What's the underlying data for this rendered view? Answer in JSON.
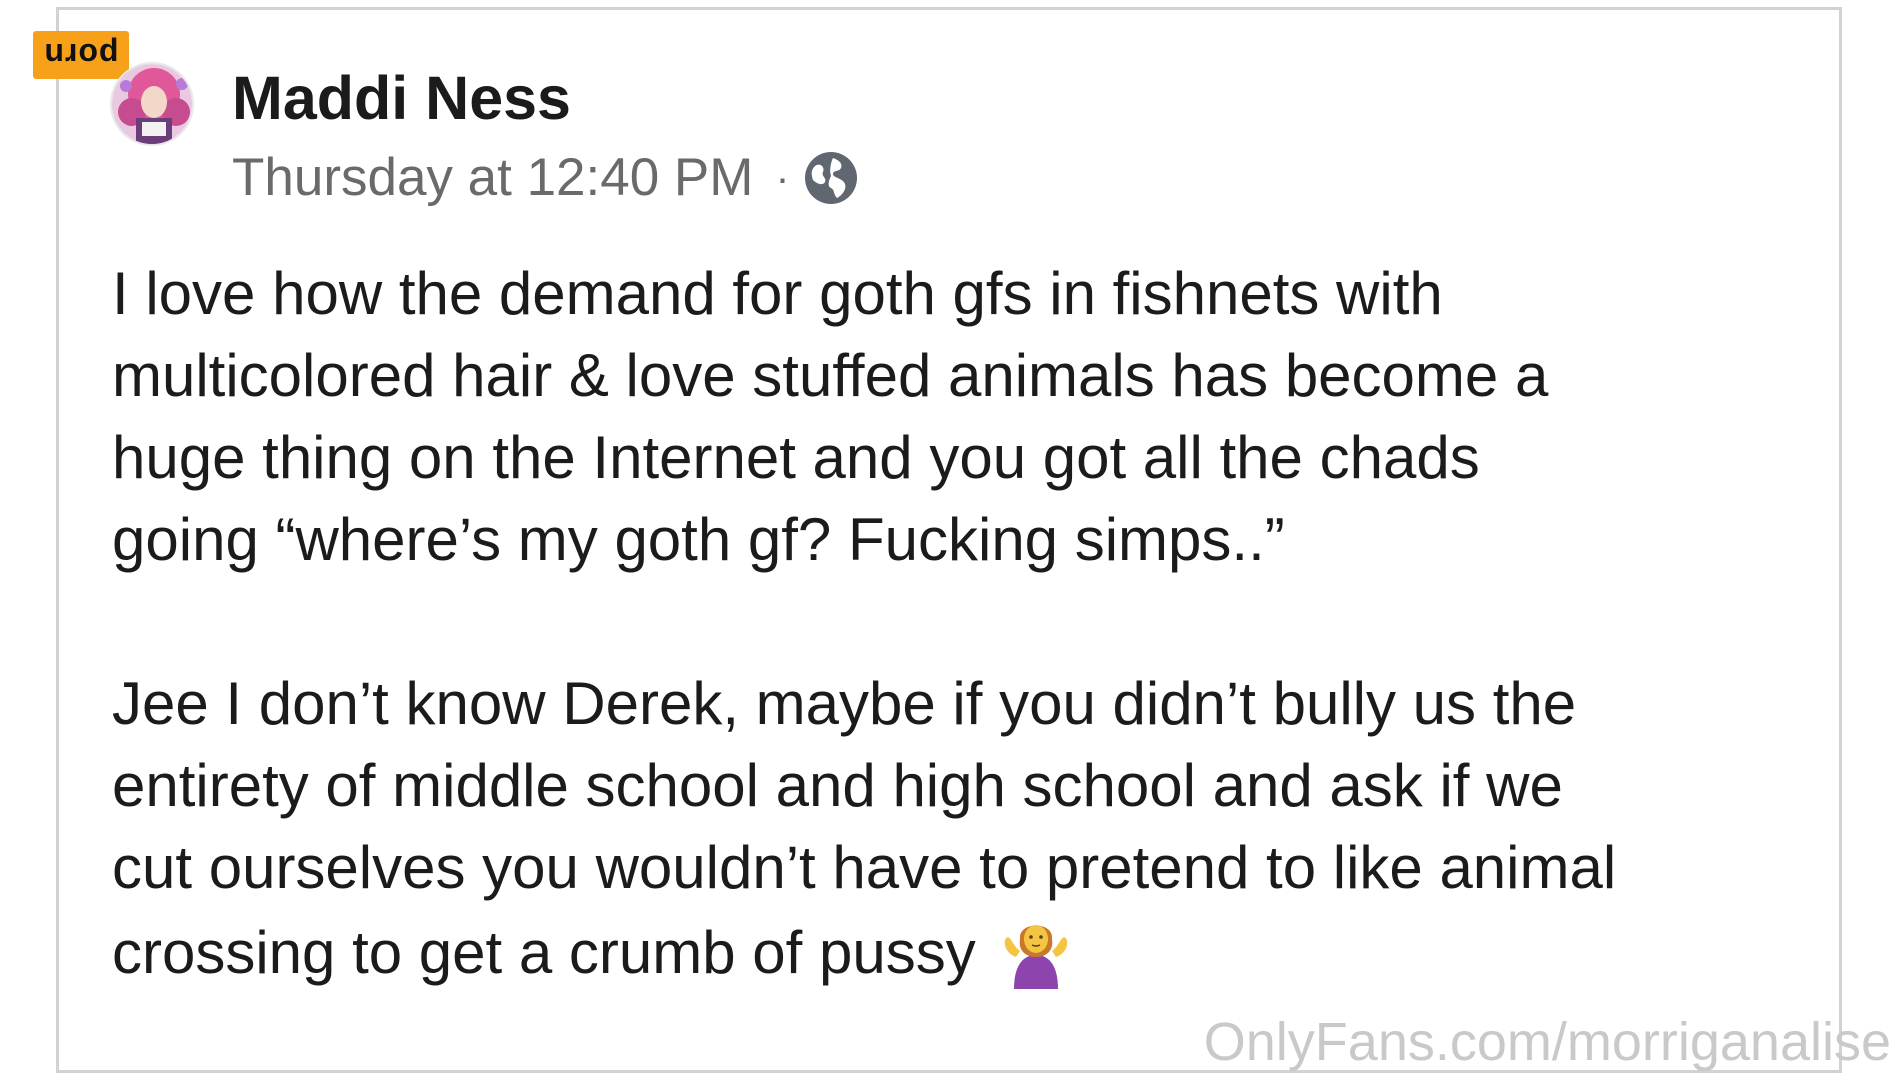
{
  "badge": {
    "label": "porn"
  },
  "post": {
    "author_name": "Maddi Ness",
    "timestamp": "Thursday at 12:40 PM",
    "separator": "·",
    "audience_icon": "globe-icon",
    "paragraphs": [
      "I love how the demand for goth gfs in fishnets with\nmulticolored hair & love stuffed animals has become a\nhuge thing on the Internet and you got all the chads\ngoing “where’s my goth gf? Fucking simps..”",
      "Jee I don’t know Derek, maybe if you didn’t bully us the\nentirety of middle school and high school and ask if we\ncut ourselves you wouldn’t have to pretend to like animal\ncrossing to get a crumb of pussy"
    ],
    "emoji_icon": "person-shrugging-emoji"
  },
  "watermark": {
    "text": "OnlyFans.com/morriganalise"
  },
  "colors": {
    "badge_bg": "#f7a11a",
    "text_primary": "#1b1b1b",
    "text_secondary": "#6a6a6a",
    "frame_border": "#d2d2d2",
    "watermark": "#c9c9c9"
  }
}
